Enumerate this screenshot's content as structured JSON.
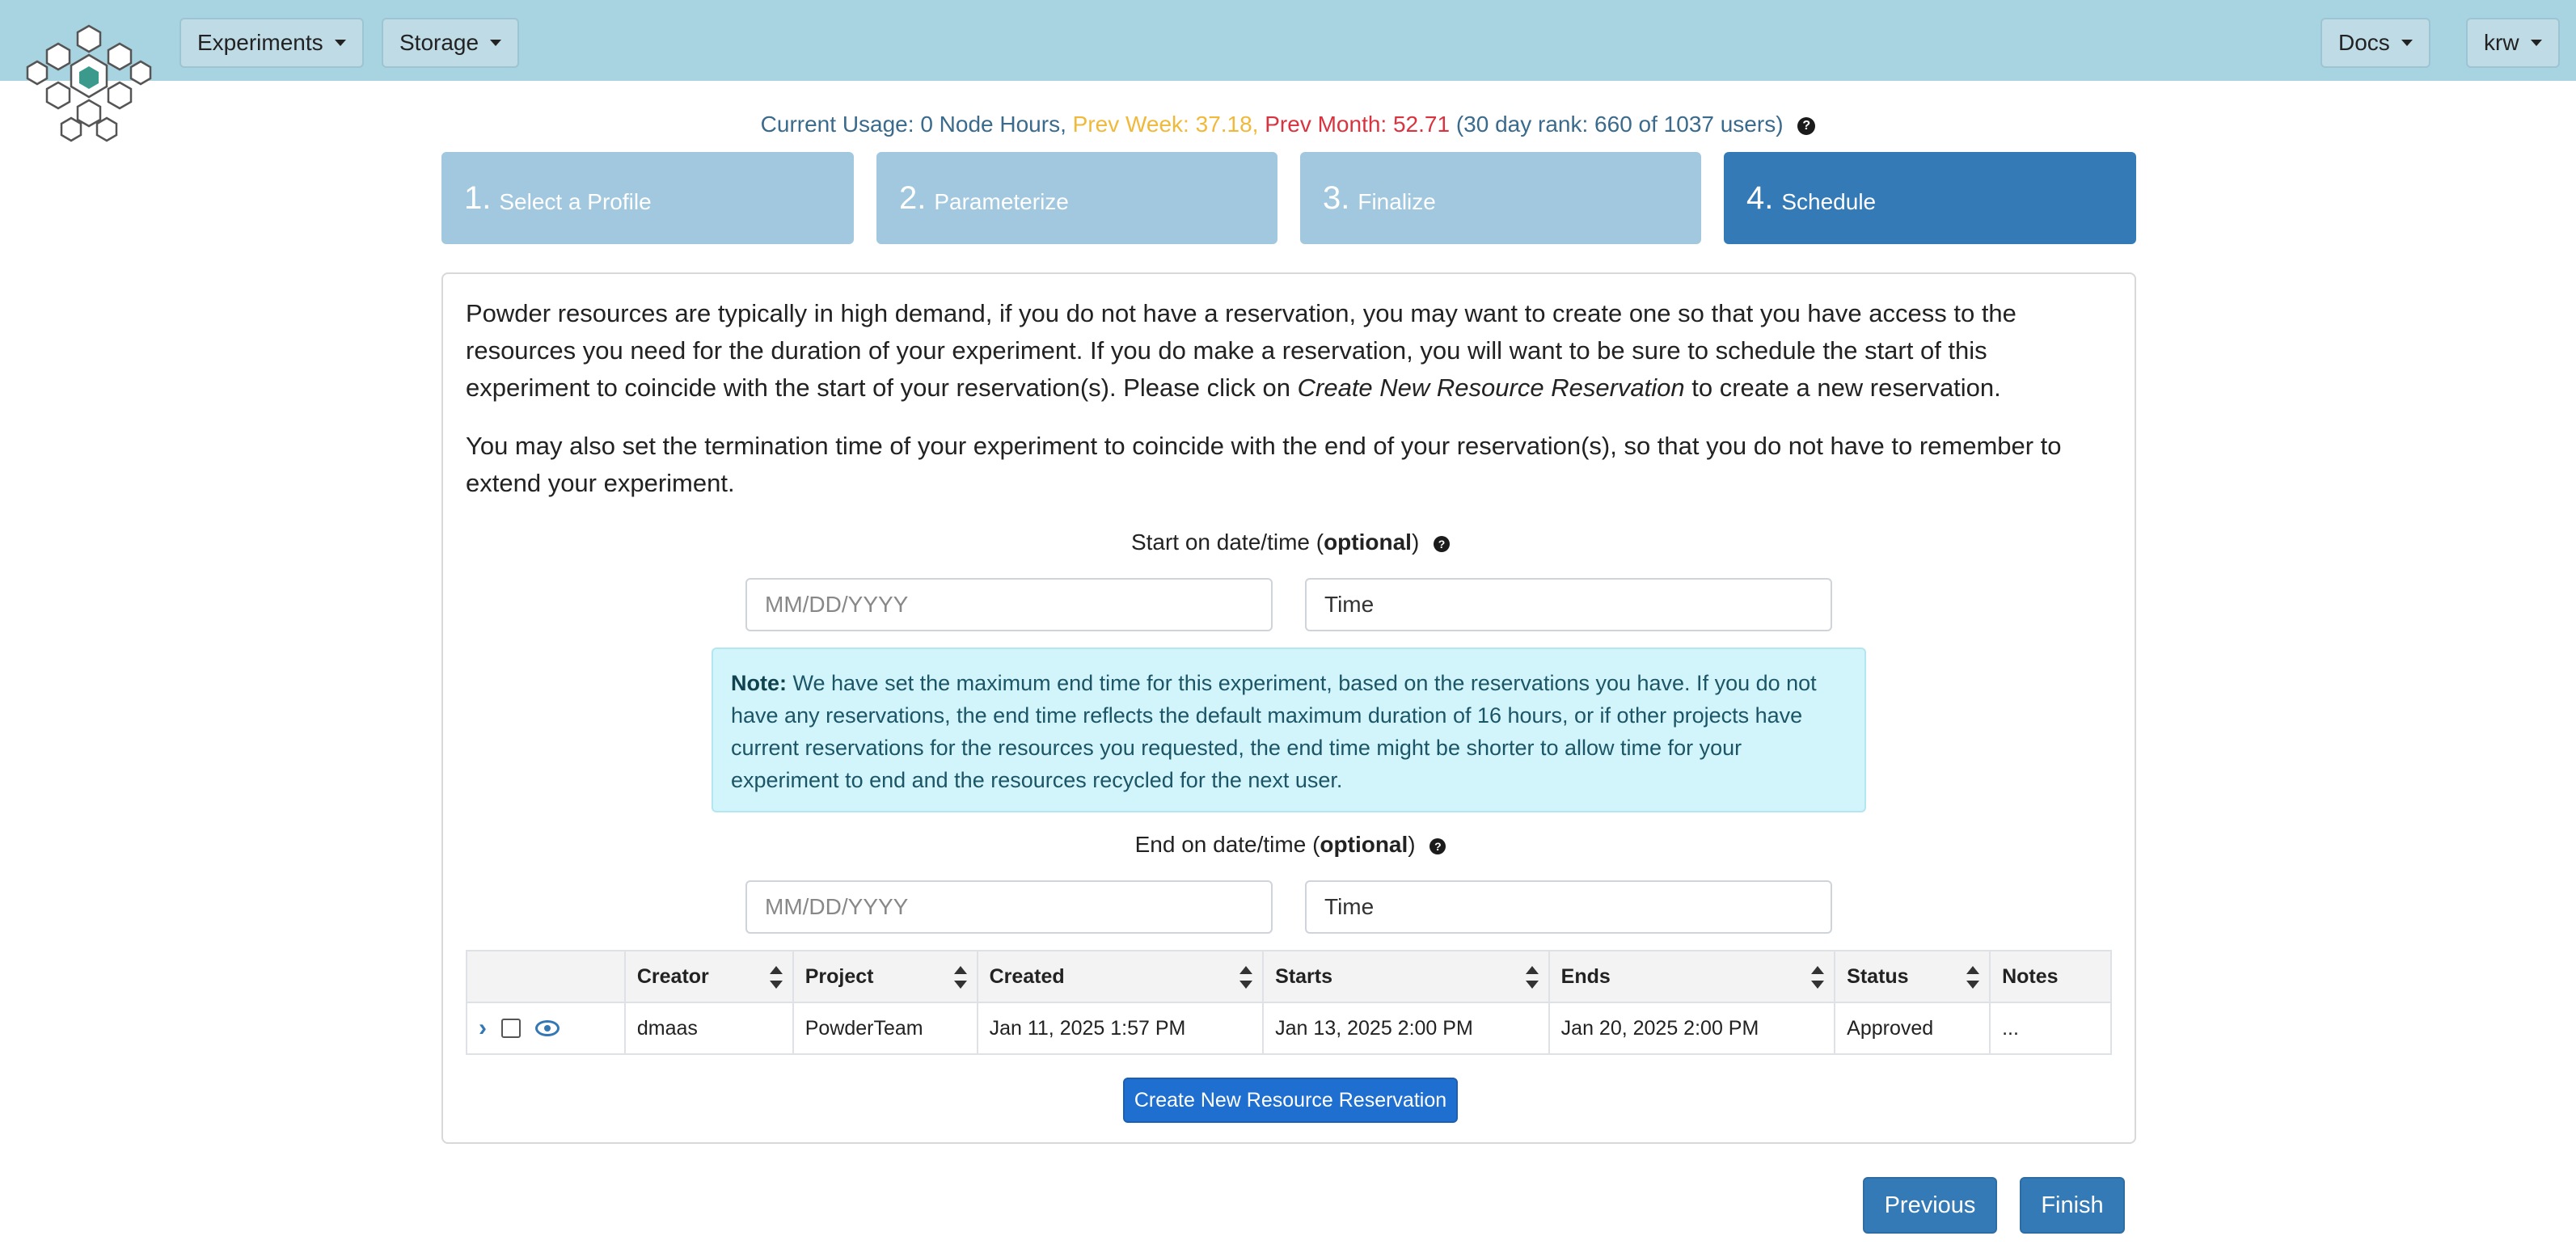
{
  "nav": {
    "experiments": "Experiments",
    "storage": "Storage",
    "docs": "Docs",
    "user": "krw"
  },
  "usage": {
    "current": "Current Usage: 0 Node Hours,",
    "prev_week": "Prev Week: 37.18,",
    "prev_month": "Prev Month: 52.71",
    "rank": "(30 day rank: 660 of 1037 users)"
  },
  "steps": [
    {
      "num": "1.",
      "label": "Select a Profile"
    },
    {
      "num": "2.",
      "label": "Parameterize"
    },
    {
      "num": "3.",
      "label": "Finalize"
    },
    {
      "num": "4.",
      "label": "Schedule"
    }
  ],
  "schedule": {
    "para1_a": "Powder resources are typically in high demand, if you do not have a reservation, you may want to create one so that you have access to the resources you need for the duration of your experiment. If you do make a reservation, you will want to be sure to schedule the start of this experiment to coincide with the start of your reservation(s). Please click on ",
    "para1_em": "Create New Resource Reservation",
    "para1_b": " to create a new reservation.",
    "para2": "You may also set the termination time of your experiment to coincide with the end of your reservation(s), so that you do not have to remember to extend your experiment.",
    "start_label": "Start on date/time (",
    "end_label": "End on date/time (",
    "optional": "optional",
    "close_paren": ")",
    "date_placeholder": "MM/DD/YYYY",
    "time_value": "Time",
    "note_bold": "Note:",
    "note_text": " We have set the maximum end time for this experiment, based on the reservations you have. If you do not have any reservations, the end time reflects the default maximum duration of 16 hours, or if other projects have current reservations for the resources you requested, the end time might be shorter to allow time for your experiment to end and the resources recycled for the next user."
  },
  "table": {
    "headers": [
      "Creator",
      "Project",
      "Created",
      "Starts",
      "Ends",
      "Status",
      "Notes"
    ],
    "rows": [
      {
        "creator": "dmaas",
        "project": "PowderTeam",
        "created": "Jan 11, 2025 1:57 PM",
        "starts": "Jan 13, 2025 2:00 PM",
        "ends": "Jan 20, 2025 2:00 PM",
        "status": "Approved",
        "notes": "..."
      }
    ]
  },
  "buttons": {
    "create": "Create New Resource Reservation",
    "previous": "Previous",
    "finish": "Finish"
  },
  "colors": {
    "navbar": "#a8d3e1",
    "step_active": "#337ab7",
    "step_inactive": "#a1c8de",
    "prev_week": "#f0b93a",
    "prev_month": "#d9333f"
  }
}
